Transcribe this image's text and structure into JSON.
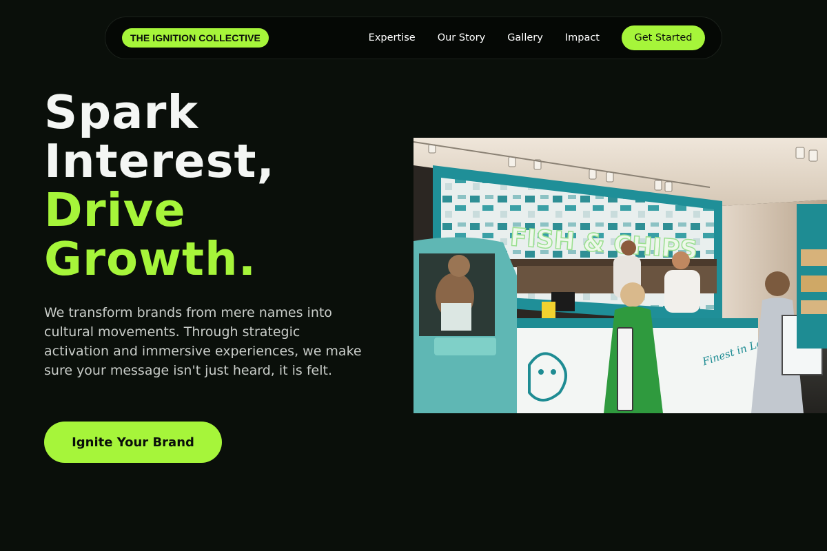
{
  "nav": {
    "brand": "THE IGNITION COLLECTIVE",
    "links": [
      "Expertise",
      "Our Story",
      "Gallery",
      "Impact"
    ],
    "cta": "Get Started"
  },
  "hero": {
    "title_line1": "Spark",
    "title_line2": "Interest,",
    "title_line3": "Drive",
    "title_line4": "Growth.",
    "description": "We transform brands from mere names into cultural movements. Through strategic activation and immersive experiences, we make sure your message isn't just heard, it is felt.",
    "cta": "Ignite Your Brand"
  },
  "photo": {
    "sign_text": "FISH & CHIPS",
    "counter_script": "Finest in London!"
  },
  "colors": {
    "background": "#0a0f0a",
    "accent": "#a6f53a",
    "text": "#ffffff",
    "muted_text": "#c9cdc9"
  }
}
